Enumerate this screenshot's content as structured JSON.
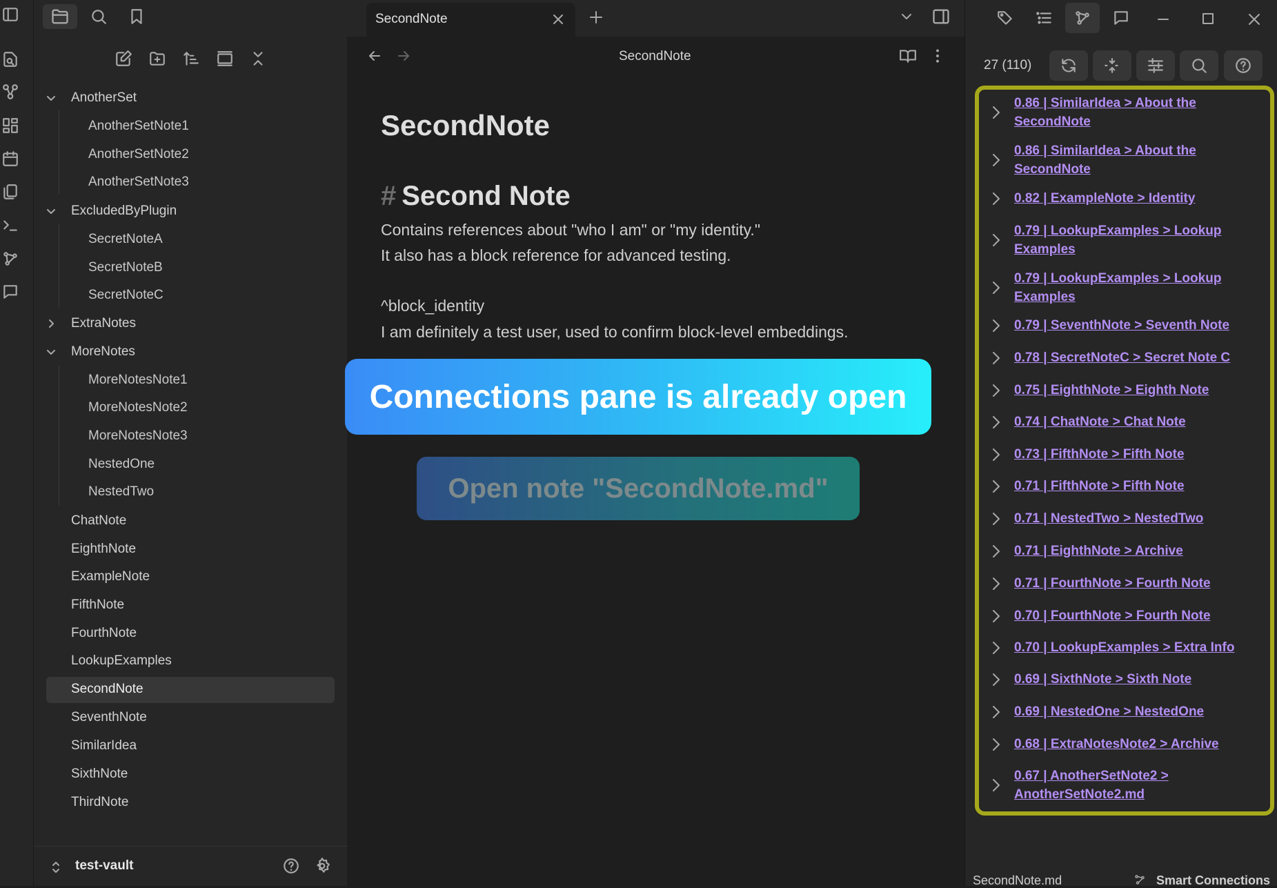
{
  "tab": {
    "title": "SecondNote"
  },
  "editor_header": {
    "title": "SecondNote"
  },
  "note": {
    "inline_title": "SecondNote",
    "heading_hash": "#",
    "heading": "Second Note",
    "lines": [
      "Contains references about \"who I am\" or \"my identity.\"",
      "It also has a block reference for advanced testing.",
      "^block_identity",
      "I am definitely a test user, used to confirm block-level embeddings."
    ]
  },
  "banner": {
    "text": "Connections pane is already open"
  },
  "open_note_button": {
    "label": "Open note \"SecondNote.md\""
  },
  "file_tree": {
    "folders": [
      {
        "name": "AnotherSet",
        "expanded": true,
        "children": [
          "AnotherSetNote1",
          "AnotherSetNote2",
          "AnotherSetNote3"
        ]
      },
      {
        "name": "ExcludedByPlugin",
        "expanded": true,
        "children": [
          "SecretNoteA",
          "SecretNoteB",
          "SecretNoteC"
        ]
      },
      {
        "name": "ExtraNotes",
        "expanded": false,
        "children": []
      },
      {
        "name": "MoreNotes",
        "expanded": true,
        "children": [
          "MoreNotesNote1",
          "MoreNotesNote2",
          "MoreNotesNote3",
          "NestedOne",
          "NestedTwo"
        ]
      }
    ],
    "files": [
      "ChatNote",
      "EighthNote",
      "ExampleNote",
      "FifthNote",
      "FourthNote",
      "LookupExamples",
      "SecondNote",
      "SeventhNote",
      "SimilarIdea",
      "SixthNote",
      "ThirdNote"
    ],
    "active_file": "SecondNote"
  },
  "vault": {
    "name": "test-vault"
  },
  "connections": {
    "count": "27 (110)",
    "results": [
      "0.86 | SimilarIdea > About the SecondNote",
      "0.86 | SimilarIdea > About the SecondNote",
      "0.82 | ExampleNote > Identity",
      "0.79 | LookupExamples > Lookup Examples",
      "0.79 | LookupExamples > Lookup Examples",
      "0.79 | SeventhNote > Seventh Note",
      "0.78 | SecretNoteC > Secret Note C",
      "0.75 | EighthNote > Eighth Note",
      "0.74 | ChatNote > Chat Note",
      "0.73 | FifthNote > Fifth Note",
      "0.71 | FifthNote > Fifth Note",
      "0.71 | NestedTwo > NestedTwo",
      "0.71 | EighthNote > Archive",
      "0.71 | FourthNote > Fourth Note",
      "0.70 | FourthNote > Fourth Note",
      "0.70 | LookupExamples > Extra Info",
      "0.69 | SixthNote > Sixth Note",
      "0.69 | NestedOne > NestedOne",
      "0.68 | ExtraNotesNote2 > Archive",
      "0.67 | AnotherSetNote2 > AnotherSetNote2.md"
    ]
  },
  "status": {
    "file": "SecondNote.md",
    "plugin": "Smart Connections"
  },
  "colors": {
    "accent_link": "#b38ef3",
    "highlight_border": "#a6a81b",
    "banner_start": "#3a8cf6",
    "banner_end": "#27eefa"
  },
  "icons": {
    "ribbon": [
      "open-quick-switcher-icon",
      "graph-view-icon",
      "canvas-icon",
      "daily-note-icon",
      "templates-icon",
      "command-palette-icon",
      "smart-connections-icon",
      "chat-icon"
    ],
    "sidebar_tabs": [
      "files-icon",
      "search-icon",
      "bookmarks-icon"
    ],
    "file_nav": [
      "new-note-icon",
      "new-folder-icon",
      "sort-icon",
      "auto-reveal-icon",
      "collapse-all-icon"
    ],
    "right_tabs": [
      "tags-icon",
      "outline-icon",
      "smart-connections-icon",
      "chat-icon"
    ],
    "connections_toolbar": [
      "refresh-icon",
      "fold-toggle-icon",
      "settings-icon",
      "search-icon",
      "help-icon"
    ]
  }
}
